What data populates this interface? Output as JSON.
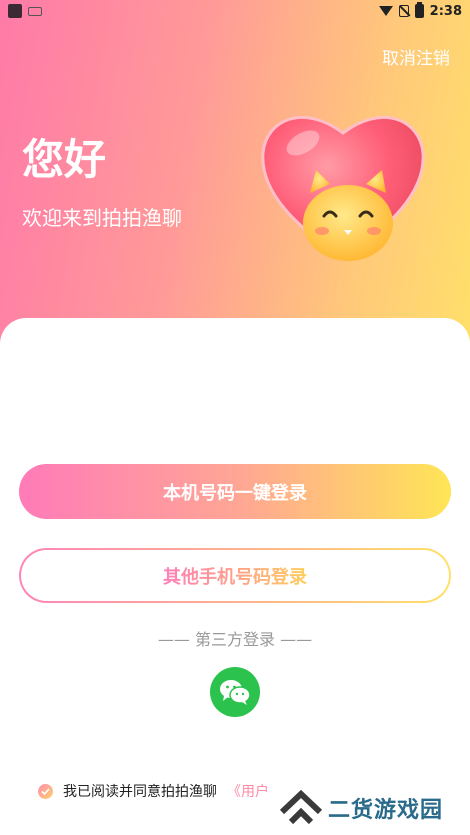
{
  "status_bar": {
    "time": "2:38",
    "icons": [
      "app-icon",
      "notification-icon",
      "wifi-icon",
      "no-sim-icon",
      "battery-icon"
    ]
  },
  "header": {
    "cancel_label": "取消注销",
    "greeting": "您好",
    "welcome": "欢迎来到拍拍渔聊",
    "mascot_icon": "heart-cat-mascot"
  },
  "login": {
    "one_click_label": "本机号码一键登录",
    "other_phone_label": "其他手机号码登录",
    "third_party_label": "—— 第三方登录 ——",
    "wechat_icon": "wechat-icon"
  },
  "agreement": {
    "text": "我已阅读并同意拍拍渔聊",
    "link_text": "《用户"
  },
  "watermark": {
    "text": "二货游戏园",
    "logo_icon": "house-chevron-logo"
  },
  "colors": {
    "gradient_pink": "#ff7aa8",
    "gradient_yellow": "#ffe06a",
    "wechat_green": "#2bc34e",
    "link_pink": "#ff8aa8"
  }
}
